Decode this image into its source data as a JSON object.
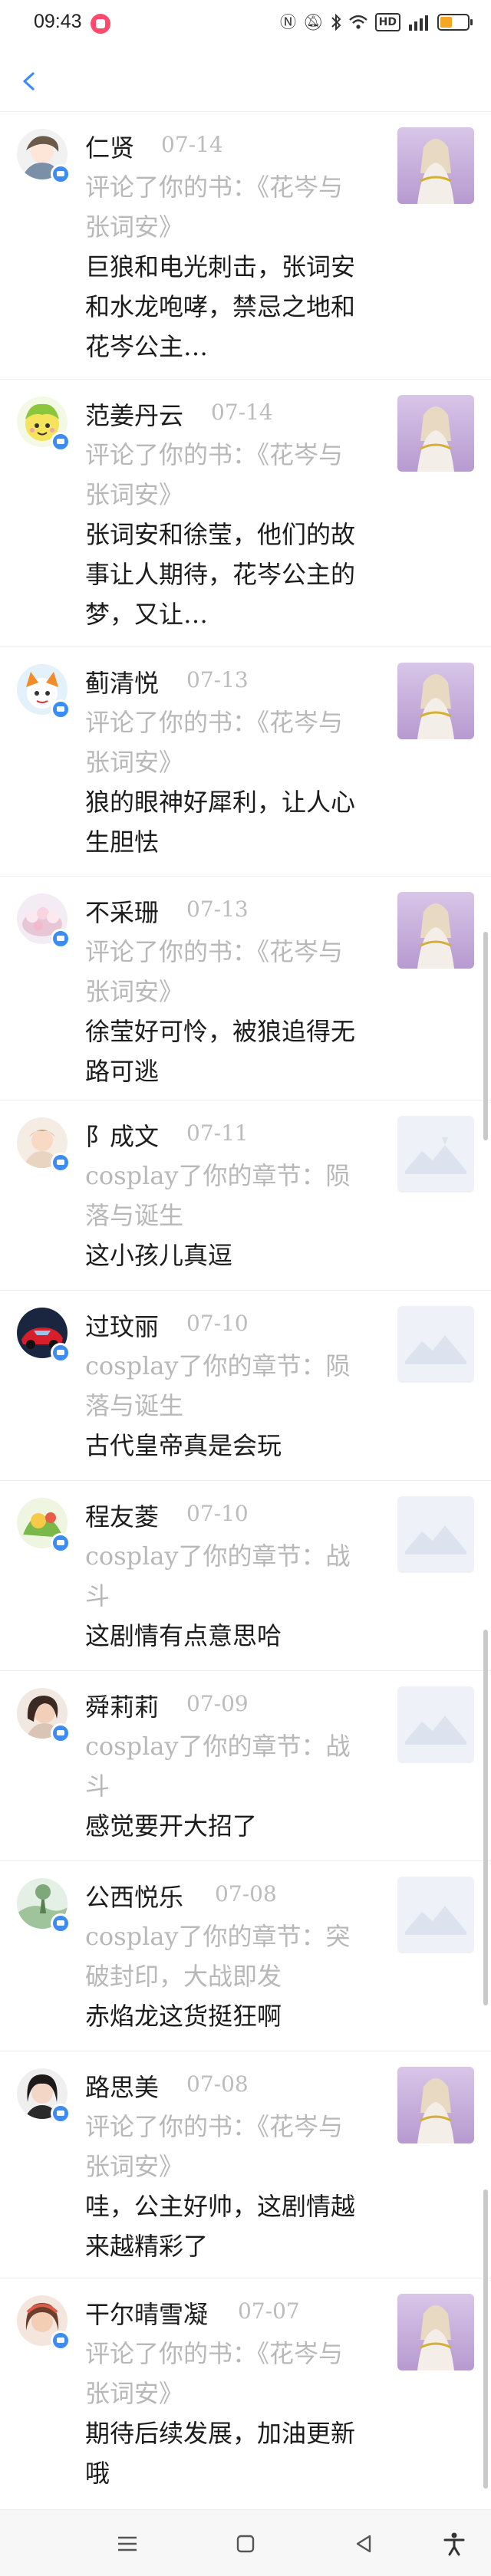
{
  "status_bar": {
    "time": "09:43",
    "icons": [
      "app-notification-icon",
      "nfc-icon",
      "mute-icon",
      "bluetooth-icon",
      "wifi-icon",
      "hd-icon",
      "signal-icon",
      "battery-icon"
    ],
    "hd_label": "HD",
    "battery_level": 0.45
  },
  "nav": {
    "back_icon": "chevron-left-icon"
  },
  "items": [
    {
      "name": "仁贤",
      "date": "07-14",
      "action": "评论了你的书：《花岑与张词安》",
      "comment": "巨狼和电光刺击，张词安和水龙咆哮，禁忌之地和花岑公主…",
      "target": "book-cover"
    },
    {
      "name": "范姜丹云",
      "date": "07-14",
      "action": "评论了你的书：《花岑与张词安》",
      "comment": "张词安和徐莹，他们的故事让人期待，花岑公主的梦，又让…",
      "target": "book-cover"
    },
    {
      "name": "蓟清悦",
      "date": "07-13",
      "action": "评论了你的书：《花岑与张词安》",
      "comment": "狼的眼神好犀利，让人心生胆怯",
      "target": "book-cover"
    },
    {
      "name": "不采珊",
      "date": "07-13",
      "action": "评论了你的书：《花岑与张词安》",
      "comment": "徐莹好可怜，被狼追得无路可逃",
      "target": "book-cover"
    },
    {
      "name": "阝成文",
      "date": "07-11",
      "action": "cosplay了你的章节：陨落与诞生",
      "comment": "这小孩儿真逗",
      "target": "placeholder"
    },
    {
      "name": "过玟丽",
      "date": "07-10",
      "action": "cosplay了你的章节：陨落与诞生",
      "comment": "古代皇帝真是会玩",
      "target": "placeholder"
    },
    {
      "name": "程友菱",
      "date": "07-10",
      "action": "cosplay了你的章节：战斗",
      "comment": "这剧情有点意思哈",
      "target": "placeholder"
    },
    {
      "name": "舜莉莉",
      "date": "07-09",
      "action": "cosplay了你的章节：战斗",
      "comment": "感觉要开大招了",
      "target": "placeholder"
    },
    {
      "name": "公西悦乐",
      "date": "07-08",
      "action": "cosplay了你的章节：突破封印，大战即发",
      "comment": "赤焰龙这货挺狂啊",
      "target": "placeholder"
    },
    {
      "name": "路思美",
      "date": "07-08",
      "action": "评论了你的书：《花岑与张词安》",
      "comment": "哇，公主好帅，这剧情越来越精彩了",
      "target": "book-cover"
    },
    {
      "name": "干尔晴雪凝",
      "date": "07-07",
      "action": "评论了你的书：《花岑与张词安》",
      "comment": "期待后续发展，加油更新哦",
      "target": "book-cover"
    }
  ],
  "bottom_nav": {
    "icons": [
      "menu-icon",
      "home-square-icon",
      "back-triangle-icon",
      "accessibility-icon"
    ]
  }
}
